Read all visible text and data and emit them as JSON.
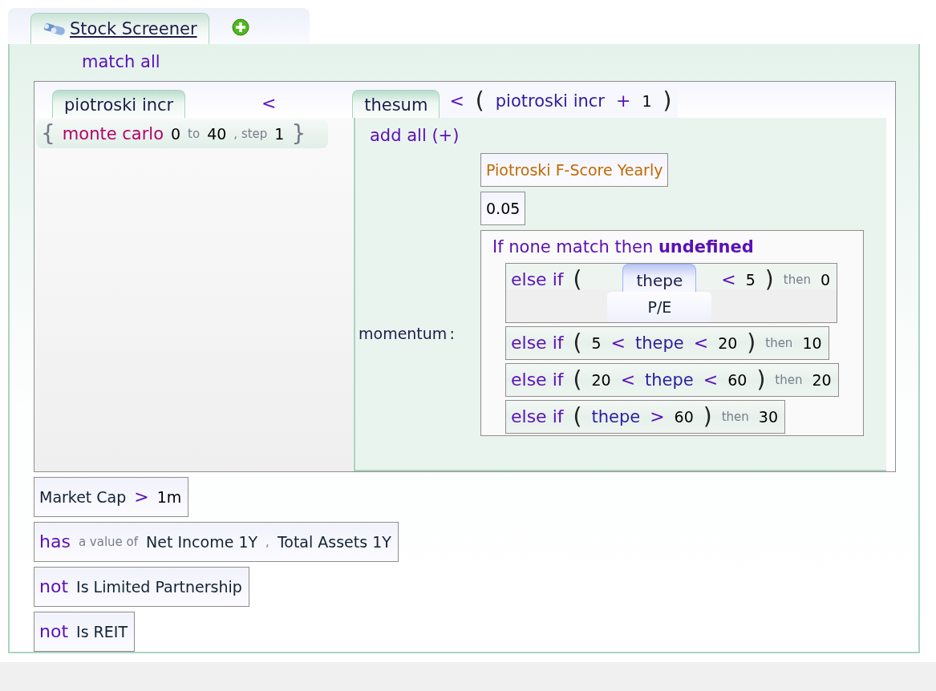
{
  "tabs": [
    {
      "label": "Stock Screener",
      "selected": true
    }
  ],
  "match_label": "match all",
  "variable_block": {
    "left_tab": {
      "label": "piotroski incr",
      "selected": false
    },
    "operator": "<",
    "right_tab": {
      "label": "thesum",
      "selected": false
    },
    "condition": [
      {
        "kind": "op",
        "text": "<"
      },
      {
        "kind": "paren",
        "text": "("
      },
      {
        "kind": "field",
        "text": "piotroski incr"
      },
      {
        "kind": "op",
        "text": "+"
      },
      {
        "kind": "num",
        "text": "1"
      },
      {
        "kind": "paren",
        "text": ")"
      }
    ],
    "range": [
      {
        "kind": "brace",
        "text": "{"
      },
      {
        "kind": "func",
        "text": "monte carlo"
      },
      {
        "kind": "num",
        "text": "0"
      },
      {
        "kind": "small",
        "text": "to"
      },
      {
        "kind": "num",
        "text": "40"
      },
      {
        "kind": "small",
        "text": ", step"
      },
      {
        "kind": "num",
        "text": "1"
      },
      {
        "kind": "brace",
        "text": "}"
      }
    ],
    "sum_label": "add all (+)",
    "terms": [
      {
        "kind": "metric",
        "text": "Piotroski F-Score Yearly"
      },
      {
        "kind": "num",
        "text": "0.05"
      }
    ],
    "momentum_label": "momentum",
    "momentum_sep": ":",
    "default_text": "If none match then **undefined**",
    "branches": [
      {
        "tokens": [
          {
            "kind": "keyword",
            "text": "else if"
          },
          {
            "kind": "paren",
            "text": "("
          },
          {
            "kind": "var",
            "text": "thepe",
            "caption": "P/E",
            "selected": true
          },
          {
            "kind": "op",
            "text": "<"
          },
          {
            "kind": "num",
            "text": "5"
          },
          {
            "kind": "paren",
            "text": ")"
          },
          {
            "kind": "small",
            "text": "then"
          },
          {
            "kind": "num",
            "text": "0"
          }
        ]
      },
      {
        "tokens": [
          {
            "kind": "keyword",
            "text": "else if"
          },
          {
            "kind": "paren",
            "text": "("
          },
          {
            "kind": "num",
            "text": "5"
          },
          {
            "kind": "op",
            "text": "<"
          },
          {
            "kind": "field",
            "text": "thepe"
          },
          {
            "kind": "op",
            "text": "<"
          },
          {
            "kind": "num",
            "text": "20"
          },
          {
            "kind": "paren",
            "text": ")"
          },
          {
            "kind": "small",
            "text": "then"
          },
          {
            "kind": "num",
            "text": "10"
          }
        ]
      },
      {
        "tokens": [
          {
            "kind": "keyword",
            "text": "else if"
          },
          {
            "kind": "paren",
            "text": "("
          },
          {
            "kind": "num",
            "text": "20"
          },
          {
            "kind": "op",
            "text": "<"
          },
          {
            "kind": "field",
            "text": "thepe"
          },
          {
            "kind": "op",
            "text": "<"
          },
          {
            "kind": "num",
            "text": "60"
          },
          {
            "kind": "paren",
            "text": ")"
          },
          {
            "kind": "small",
            "text": "then"
          },
          {
            "kind": "num",
            "text": "20"
          }
        ]
      },
      {
        "tokens": [
          {
            "kind": "keyword",
            "text": "else if"
          },
          {
            "kind": "paren",
            "text": "("
          },
          {
            "kind": "field",
            "text": "thepe"
          },
          {
            "kind": "op",
            "text": ">"
          },
          {
            "kind": "num",
            "text": "60"
          },
          {
            "kind": "paren",
            "text": ")"
          },
          {
            "kind": "small",
            "text": "then"
          },
          {
            "kind": "num",
            "text": "30"
          }
        ]
      }
    ]
  },
  "filters": [
    {
      "tokens": [
        {
          "kind": "name",
          "text": "Market Cap"
        },
        {
          "kind": "op",
          "text": ">"
        },
        {
          "kind": "num",
          "text": "1m"
        }
      ]
    },
    {
      "tokens": [
        {
          "kind": "keyword",
          "text": "has"
        },
        {
          "kind": "small",
          "text": "a value of"
        },
        {
          "kind": "name",
          "text": "Net Income 1Y"
        },
        {
          "kind": "small",
          "text": ","
        },
        {
          "kind": "name",
          "text": "Total Assets 1Y"
        }
      ]
    },
    {
      "tokens": [
        {
          "kind": "keyword",
          "text": "not"
        },
        {
          "kind": "name",
          "text": "Is Limited Partnership"
        }
      ]
    },
    {
      "tokens": [
        {
          "kind": "keyword",
          "text": "not"
        },
        {
          "kind": "name",
          "text": "Is REIT"
        }
      ]
    }
  ]
}
